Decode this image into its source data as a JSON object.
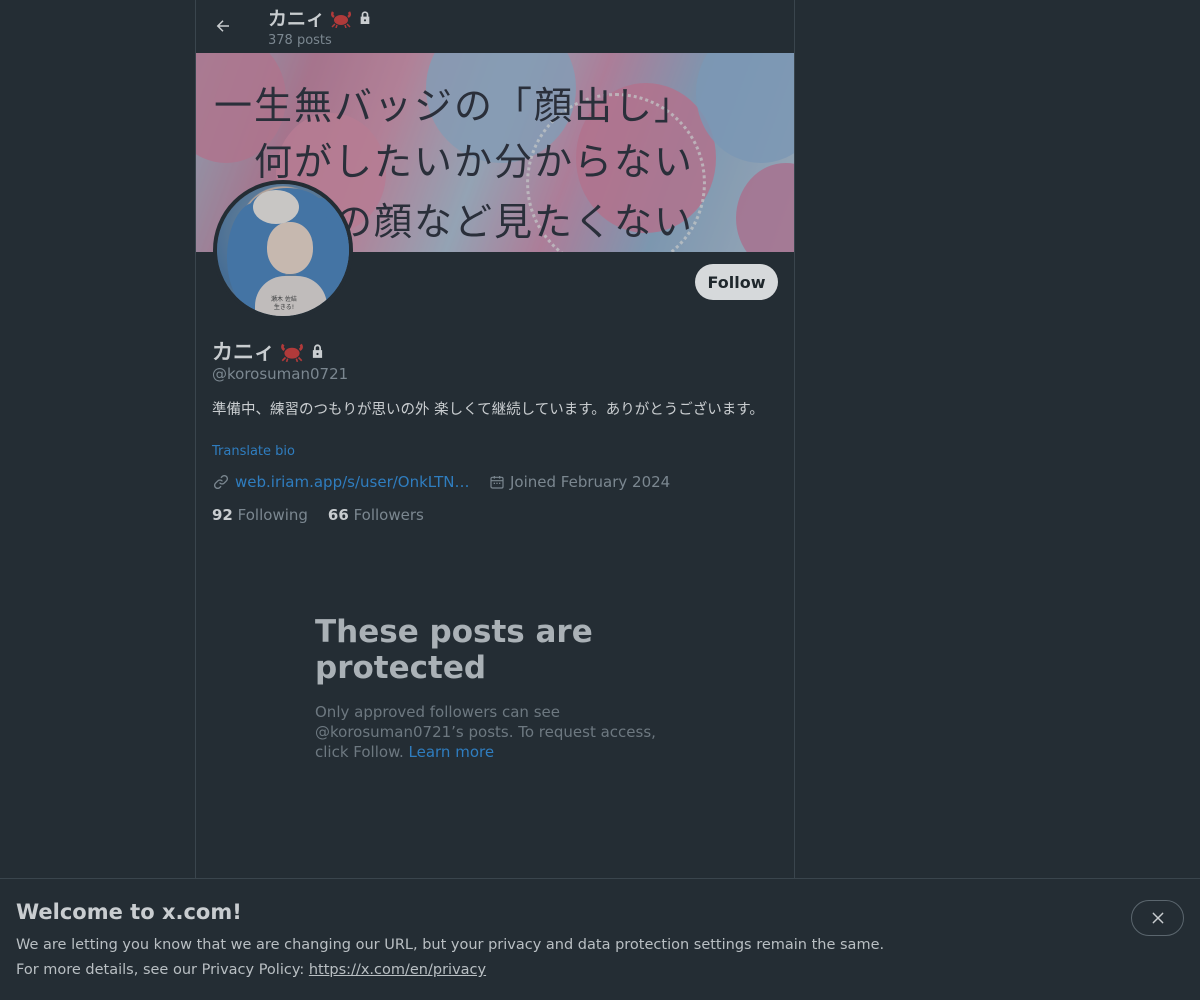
{
  "header": {
    "name": "カニィ",
    "posts_count": "378 posts"
  },
  "banner": {
    "lines": [
      "一生無バッジの「顔出し」",
      "何がしたいか分からない",
      "の顔など見たくない"
    ]
  },
  "avatar": {
    "sign_line1": "瀬木 佐結",
    "sign_line2": "生きる!"
  },
  "profile": {
    "follow_label": "Follow",
    "name": "カニィ",
    "handle": "@korosuman0721",
    "bio": "準備中、練習のつもりが思いの外 楽しくて継続しています。ありがとうございます。",
    "translate_label": "Translate bio",
    "link": "web.iriam.app/s/user/OnkLTNm…",
    "joined": "Joined February 2024",
    "following_count": "92",
    "following_label": "Following",
    "followers_count": "66",
    "followers_label": "Followers"
  },
  "protected": {
    "title": "These posts are protected",
    "desc": "Only approved followers can see @korosuman0721’s posts. To request access, click Follow.",
    "learn_more": "Learn more"
  },
  "notice": {
    "title": "Welcome to x.com!",
    "line1": "We are letting you know that we are changing our URL, but your privacy and data protection settings remain the same.",
    "line2_prefix": "For more details, see our Privacy Policy: ",
    "line2_link": "https://x.com/en/privacy"
  },
  "colors": {
    "background": "#242d34",
    "accent": "#2f7dbf",
    "crab": "#c0392b"
  }
}
